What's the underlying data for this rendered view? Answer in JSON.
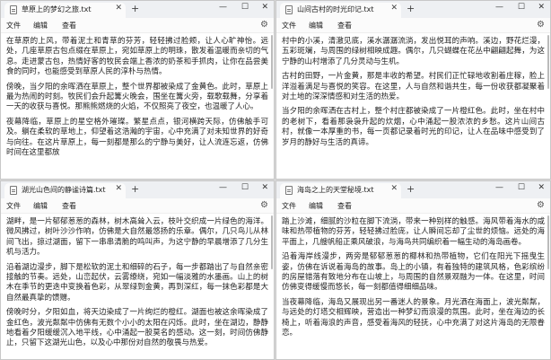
{
  "menu": {
    "file": "文件",
    "edit": "编辑",
    "view": "查看"
  },
  "windows": [
    {
      "title": "草原上的梦幻之旅.txt",
      "paragraphs": [
        "在草原的上风，带着泥土和青草的芬芳，轻轻拂过脸颊，让人心旷神怡。远处，几座草原古包点缀在草原上，宛如草原上的明珠，散发着温暖而亲切的气息。走进蒙古包，热情好客的牧民会端上香浓的奶茶和手抓肉，让你在品尝美食的同时，也能感受到草原人民的淳朴与热情。",
        "傍晚，当夕阳的余晖洒在草原上，整个世界都被染成了金黄色。此时，草原上最为热闹的时刻。牧民们会升起篝火晚会，围坐在篝火旁，载歌载舞，分享着一天的收获与喜悦。那熊熊燃烧的火焰，不仅照亮了夜空，也温暖了人心。",
        "夜幕降临，草原上的星空格外璀璨。繁星点点，银河横跨天际，仿佛触手可及。躺在柔软的草地上，仰望着这浩瀚的宇宙，心中充满了对未知世界的好奇与向往。在这片草原上，每一刻都是那么的宁静与美好，让人流连忘返，仿佛时间在这里都放"
      ]
    },
    {
      "title": "山间古村的时光印记.txt",
      "paragraphs": [
        "村中的小溪，清澈见底，溪水潺潺流淌，发出悦耳的声响。溪边，野花烂漫，五彩斑斓，与周围的绿树相映成趣。偶尔，几只蝴蝶在花丛中翩翩起舞，为这宁静的山村增添了几分灵动与生机。",
        "古村的田野，一片金黄，那是丰收的希望。村民们正忙碌地收割着庄稼，脸上洋溢着满足与喜悦的笑容。在这里，人与自然和谐共生，每一份收获都凝聚着对土地的深深情感和对生活的热爱。",
        "当夕阳的余晖洒在古村上，整个村庄都被染成了一片橙红色。此时，坐在村中的老树下，看着那袅袅升起的炊烟，心中涌起一股浓浓的乡愁。这片山间古村，就像一本厚重的书，每一页都记录着时光的印记，让人在品味中感受到了岁月的静好与生活的真谛。"
      ]
    },
    {
      "title": "湖光山色间的静谧诗篇.txt",
      "paragraphs": [
        "湖畔，是一片郁郁葱葱的森林，树木高耸入云，枝叶交织成一片绿色的海洋。微风拂过，树叶沙沙作响，仿佛是大自然最悠扬的乐章。偶尔，几只鸟儿从林间飞出，掠过湖面，留下一串串清脆的鸣叫声，为这宁静的早晨增添了几分生机与活力。",
        "沿着湖边漫步，脚下是松软的泥土和细碎的石子，每一步都踏出了与自然亲密接触的节奏。远处，山峦起伏，云雾缭绕，宛如一幅淡雅的水墨画。山上的树木在季节的更迭中变换着色彩，从翠绿到金黄，再到深红，每一抹色彩都是大自然最真挚的馈赠。",
        "傍晚时分，夕阳如血，将天边染成了一片绚烂的橙红。湖面也被这余晖染成了金红色，波光粼粼中仿佛有无数个小小的太阳在闪烁。此时，坐在湖边，静静地看着夕阳缓缓沉入地平线，心中涌起一股莫名的感动。这一刻，时间仿佛静止，只留下这湖光山色，以及心中那份对自然的敬畏与热爱。"
      ]
    },
    {
      "title": "海岛之上的天堂秘境.txt",
      "paragraphs": [
        "踏上沙滩，细腻的沙粒在脚下流淌，带来一种别样的触感。海风带着海水的咸味和热带植物的芬芳，轻轻拂过脸庞，让人瞬间忘却了尘世的烦恼。远处的海平面上，几艘帆船正乘风破浪，与海鸟共同编织着一幅生动的海岛画卷。",
        "沿着海岸线漫步，两旁是郁郁葱葱的椰林和热带植物，它们在阳光下摇曳生姿，仿佛在诉说着海岛的故事。岛上的小镇，有着独特的建筑风格，色彩缤纷的房屋错落有致地分布在山坡上，与周围的自然景观融为一体。在这里，时间仿佛变得缓慢而悠长，每一刻都值得细细品味。",
        "当夜幕降临，海岛又展现出另一番迷人的景象。月光洒在海面上，波光粼粼，与远处的灯塔交相辉映，营造出一种梦幻而浪漫的氛围。此时，坐在海边的长椅上，听着海浪的声音，感受着海风的轻抚，心中充满了对这片海岛的无限眷恋。"
      ]
    }
  ]
}
